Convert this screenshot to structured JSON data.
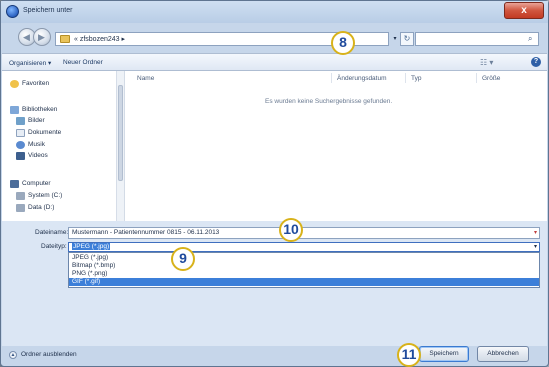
{
  "window": {
    "title": "Speichern unter",
    "close_glyph": "x"
  },
  "address": {
    "breadcrumb": "« zfsbozen243 ▸",
    "dropdown_glyph": "▾",
    "refresh_glyph": "↻",
    "search_placeholder": ""
  },
  "toolbar": {
    "organize_label": "Organisieren ▾",
    "new_folder_label": "Neuer Ordner",
    "view_glyph": "☷ ▾",
    "help_glyph": "?"
  },
  "sidebar": {
    "favorites": "Favoriten",
    "libraries": "Bibliotheken",
    "lib_items": [
      "Bilder",
      "Dokumente",
      "Musik",
      "Videos"
    ],
    "computer": "Computer",
    "drives": [
      "System (C:)",
      "Data (D:)"
    ]
  },
  "filelist": {
    "columns": [
      "Name",
      "Änderungsdatum",
      "Typ",
      "Größe"
    ],
    "empty_message": "Es wurden keine Suchergebnisse gefunden."
  },
  "form": {
    "filename_label": "Dateiname:",
    "filename_value": "Mustermann - Patientennummer 0815 - 06.11.2013",
    "filetype_label": "Dateityp:",
    "filetype_selected": "JPEG (*.jpg)",
    "filetype_options": [
      "JPEG (*.jpg)",
      "Bitmap (*.bmp)",
      "PNG (*.png)",
      "GIF (*.gif)"
    ],
    "filetype_highlighted_index": 3
  },
  "footer": {
    "collapse_label": "Ordner ausblenden",
    "save_label": "Speichern",
    "cancel_label": "Abbrechen"
  },
  "callouts": {
    "step8": "8",
    "step9": "9",
    "step10": "10",
    "step11": "11"
  },
  "colors": {
    "accent": "#3c7fd9",
    "callout_border": "#d8b21a",
    "callout_text": "#1f4a9c",
    "close_button": "#c23a23"
  }
}
